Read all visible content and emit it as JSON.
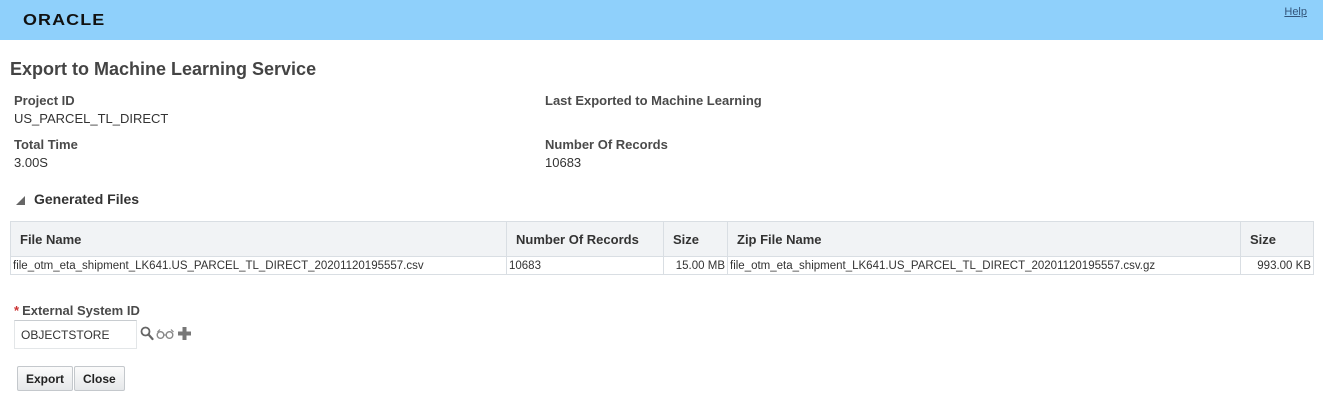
{
  "header": {
    "logo_text": "ORACLE",
    "help_label": "Help",
    "background_color": "#8fd0fb"
  },
  "page": {
    "title": "Export to Machine Learning Service"
  },
  "summary": {
    "project_id_label": "Project ID",
    "project_id_value": "US_PARCEL_TL_DIRECT",
    "last_exported_label": "Last Exported to Machine Learning",
    "last_exported_value": "",
    "total_time_label": "Total Time",
    "total_time_value": "3.00S",
    "number_of_records_label": "Number Of Records",
    "number_of_records_value": "10683"
  },
  "generated_files": {
    "section_title": "Generated Files",
    "columns": [
      "File Name",
      "Number Of Records",
      "Size",
      "Zip File Name",
      "Size"
    ],
    "rows": [
      {
        "file_name": "file_otm_eta_shipment_LK641.US_PARCEL_TL_DIRECT_20201120195557.csv",
        "records": "10683",
        "size": "15.00 MB",
        "zip_file_name": "file_otm_eta_shipment_LK641.US_PARCEL_TL_DIRECT_20201120195557.csv.gz",
        "zip_size": "993.00 KB"
      }
    ]
  },
  "external_system": {
    "required_marker": "*",
    "label": "External System ID",
    "value": "OBJECTSTORE",
    "icons": [
      "search-icon",
      "view-details-icon",
      "add-icon"
    ]
  },
  "actions": {
    "export_label": "Export",
    "close_label": "Close"
  }
}
